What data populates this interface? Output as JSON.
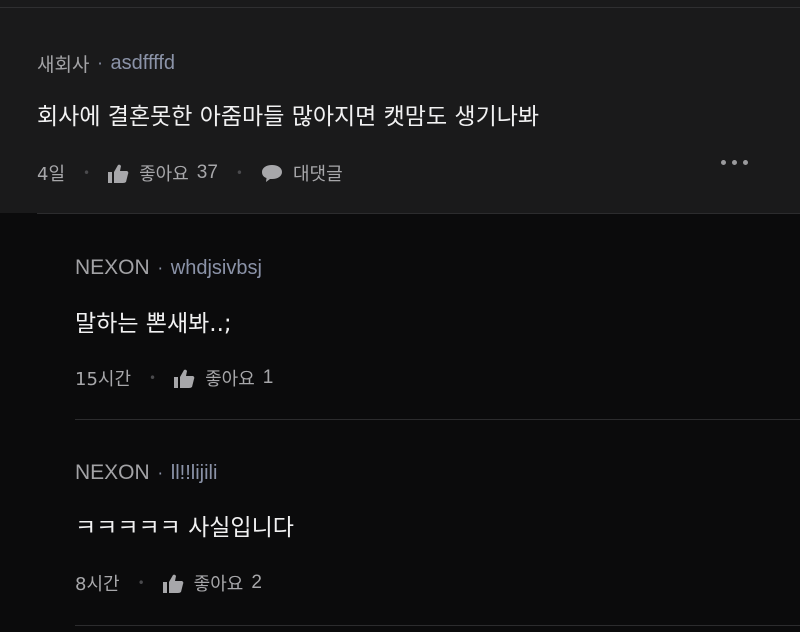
{
  "comments": [
    {
      "nickname": "새회사",
      "dot": "·",
      "user_id": "asdffffd",
      "text": "회사에 결혼못한 아줌마들 많아지면 캣맘도 생기나봐",
      "time": "4일",
      "like_label": "좋아요",
      "like_count": "37",
      "reply_label": "대댓글"
    },
    {
      "nickname": "NEXON",
      "dot": "·",
      "user_id": "whdjsivbsj",
      "text": "말하는 뽄새봐..;",
      "time": "15시간",
      "like_label": "좋아요",
      "like_count": "1"
    },
    {
      "nickname": "NEXON",
      "dot": "·",
      "user_id": "ll!!lijili",
      "text": "ㅋㅋㅋㅋㅋ 사실입니다",
      "time": "8시간",
      "like_label": "좋아요",
      "like_count": "2"
    }
  ],
  "icons": {
    "like": "thumbs-up-icon",
    "reply": "speech-bubble-icon",
    "more": "more-dots-icon"
  },
  "colors": {
    "background": "#0b0b0c",
    "highlight_background": "#1a1a1b",
    "user_id": "#8b93a8",
    "text": "#f1f1f2",
    "muted": "#a7a7aa"
  }
}
